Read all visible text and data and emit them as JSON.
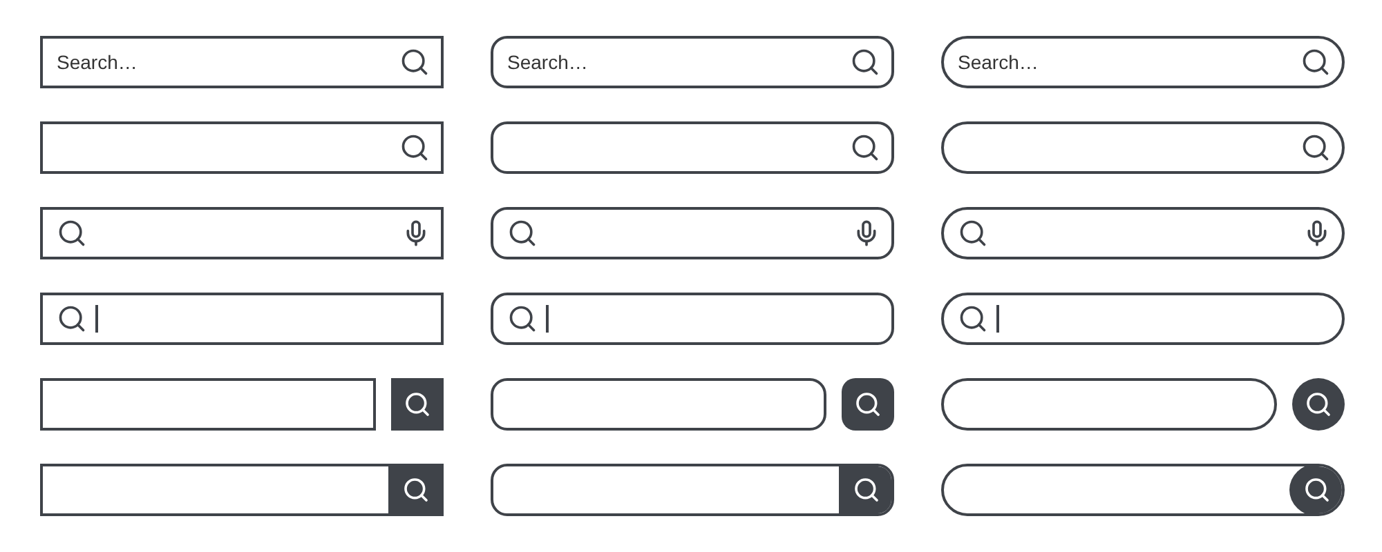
{
  "columns": [
    {
      "kind": "square",
      "bars": [
        {
          "kind": "placeholder",
          "placeholder": "Search…"
        },
        {
          "kind": "icon-right"
        },
        {
          "kind": "voice"
        },
        {
          "kind": "cursor"
        },
        {
          "kind": "separate-button"
        },
        {
          "kind": "attached-button"
        }
      ]
    },
    {
      "kind": "rounded",
      "bars": [
        {
          "kind": "placeholder",
          "placeholder": "Search…"
        },
        {
          "kind": "icon-right"
        },
        {
          "kind": "voice"
        },
        {
          "kind": "cursor"
        },
        {
          "kind": "separate-button"
        },
        {
          "kind": "attached-button"
        }
      ]
    },
    {
      "kind": "pill",
      "bars": [
        {
          "kind": "placeholder",
          "placeholder": "Search…"
        },
        {
          "kind": "icon-right"
        },
        {
          "kind": "voice"
        },
        {
          "kind": "cursor"
        },
        {
          "kind": "separate-button"
        },
        {
          "kind": "attached-button"
        }
      ]
    }
  ]
}
